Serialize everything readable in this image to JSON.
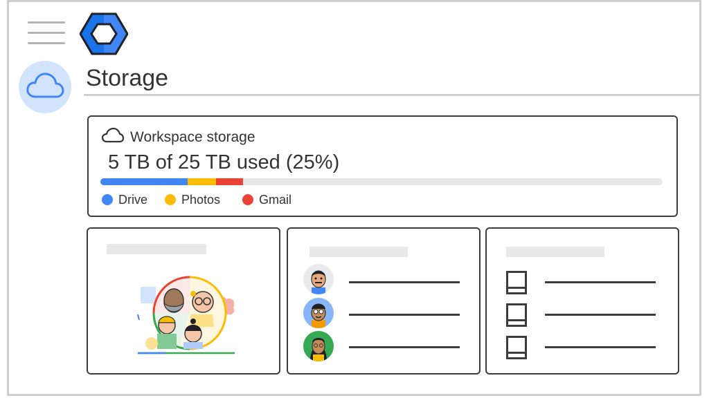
{
  "header": {
    "menu_icon": "hamburger-menu-icon",
    "logo_icon": "hexagon-logo-icon",
    "section_icon": "cloud-icon",
    "title": "Storage"
  },
  "storage": {
    "icon": "cloud-outline-icon",
    "label": "Workspace storage",
    "usage_text": "5 TB of 25 TB used (25%)",
    "used_fraction": 0.25,
    "segments": [
      {
        "name": "Drive",
        "color": "#4285F4",
        "fraction": 0.155
      },
      {
        "name": "Photos",
        "color": "#FBBC04",
        "fraction": 0.05
      },
      {
        "name": "Gmail",
        "color": "#EA4335",
        "fraction": 0.048
      }
    ],
    "legend": [
      {
        "label": "Drive",
        "color": "#4285F4"
      },
      {
        "label": "Photos",
        "color": "#FBBC04"
      },
      {
        "label": "Gmail",
        "color": "#EA4335"
      }
    ]
  },
  "panels": {
    "panel1": {
      "illustration": "people-group-illustration"
    },
    "panel2": {
      "items": [
        {
          "icon": "person-avatar"
        },
        {
          "icon": "person-avatar"
        },
        {
          "icon": "person-avatar"
        }
      ]
    },
    "panel3": {
      "items": [
        {
          "icon": "tray-icon"
        },
        {
          "icon": "tray-icon"
        },
        {
          "icon": "tray-icon"
        }
      ]
    }
  },
  "colors": {
    "blue": "#4285F4",
    "yellow": "#FBBC04",
    "red": "#EA4335",
    "green": "#34A853",
    "accent_bg": "#D2E3FC"
  }
}
